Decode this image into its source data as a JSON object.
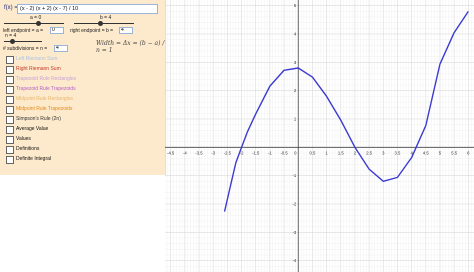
{
  "function": {
    "label": "f(x) =",
    "value": "(x - 2) (x + 2) (x - 7) / 10"
  },
  "sliders": {
    "a_caption": "a = 0",
    "b_caption": "b = 4",
    "n_caption": "n = 4"
  },
  "fields": {
    "left_label": "left endpoint = a =",
    "left_value": "0",
    "right_label": "right endpoint = b =",
    "right_value": "4",
    "subdiv_label": "# subdivisions = n =",
    "subdiv_value": "4"
  },
  "width_formula": "Width = Δx = (b − a) / n = 1",
  "checkboxes": [
    {
      "label": "Left Riemann Sum",
      "color": "#a9c4e8"
    },
    {
      "label": "Right Riemann Sum",
      "color": "#c0392b"
    },
    {
      "label": "Trapezoid Rule Rectangles",
      "color": "#c8a3d8"
    },
    {
      "label": "Trapezoid Rule Trapezoids",
      "color": "#b55fc9"
    },
    {
      "label": "Midpoint Rule Rectangles",
      "color": "#e8b86a"
    },
    {
      "label": "Midpoint Rule Trapezoids",
      "color": "#e08a1e"
    },
    {
      "label": "Simpson's Rule (2n)",
      "color": "#333333"
    },
    {
      "label": "Average Value",
      "color": "#111111"
    },
    {
      "label": "Values",
      "color": "#111111"
    },
    {
      "label": "Definitions",
      "color": "#111111"
    },
    {
      "label": "Definite Integral",
      "color": "#111111"
    }
  ],
  "graph": {
    "curve_color": "#3b3bd1",
    "x_ticks": [
      "-4.5",
      "-4",
      "-3.5",
      "-3",
      "-2.5",
      "-2",
      "-1.5",
      "-1",
      "-0.5",
      "0",
      "0.5",
      "1",
      "1.5",
      "2",
      "2.5",
      "3",
      "3.5",
      "4",
      "4.5",
      "5",
      "5.5",
      "6"
    ],
    "y_ticks": [
      "5",
      "4",
      "3",
      "2",
      "1",
      "-1",
      "-2",
      "-3",
      "-4"
    ]
  },
  "chart_data": {
    "type": "line",
    "title": "",
    "xlabel": "",
    "ylabel": "",
    "xlim": [
      -4.7,
      6.2
    ],
    "ylim": [
      -4.4,
      5.2
    ],
    "series": [
      {
        "x": [
          -2.6,
          -2.4,
          -2.2,
          -2,
          -1.8,
          -1.5,
          -1,
          -0.5,
          0,
          0.5,
          1,
          1.5,
          2,
          2.5,
          3,
          3.5,
          4,
          4.5,
          5,
          5.5,
          6
        ],
        "y": [
          -2.27,
          -1.4,
          -0.54,
          0,
          0.53,
          1.18,
          2.16,
          2.72,
          2.8,
          2.48,
          1.8,
          0.96,
          0,
          -0.77,
          -1.2,
          -1.06,
          -0.36,
          0.77,
          2.94,
          4.05,
          4.8
        ]
      }
    ]
  }
}
